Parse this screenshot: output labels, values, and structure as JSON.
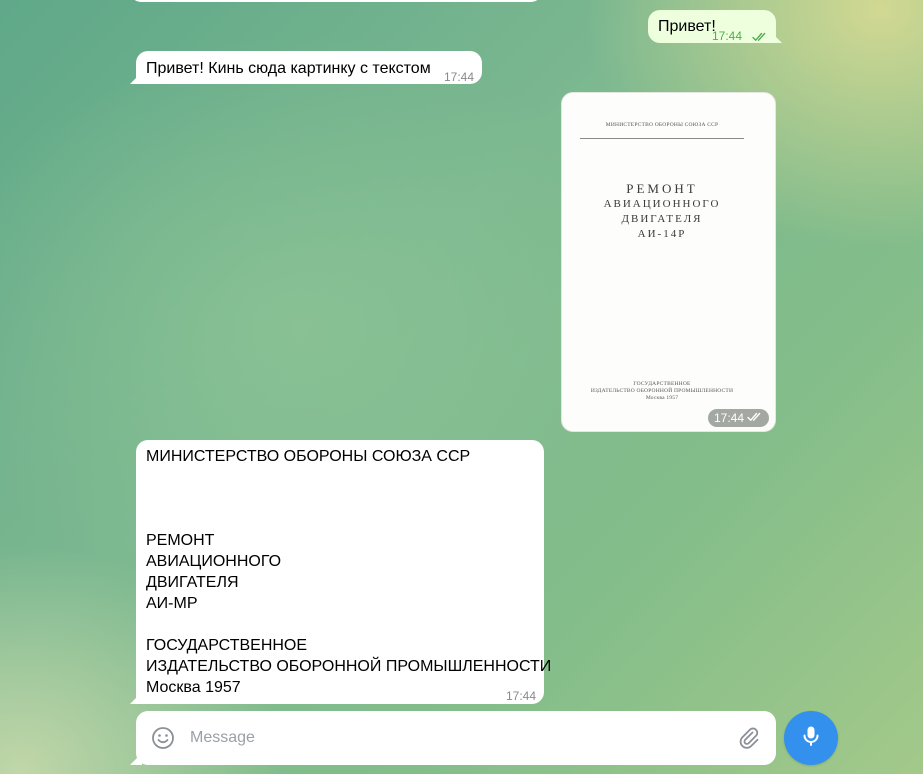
{
  "messages": {
    "greeting": {
      "text": "Привет!",
      "time": "17:44"
    },
    "request": {
      "text": "Привет! Кинь сюда картинку с текстом",
      "time": "17:44"
    },
    "photo": {
      "time": "17:44",
      "document": {
        "header": "МИНИСТЕРСТВО ОБОРОНЫ СОЮЗА ССР",
        "title_1": "РЕМОНТ",
        "title_2": "АВИАЦИОННОГО",
        "title_3": "ДВИГАТЕЛЯ",
        "title_4": "АИ-14Р",
        "footer_1": "ГОСУДАРСТВЕННОЕ",
        "footer_2": "ИЗДАТЕЛЬСТВО ОБОРОННОЙ ПРОМЫШЛЕННОСТИ",
        "footer_3": "Москва 1957"
      }
    },
    "ocr": {
      "lines": [
        "МИНИСТЕРСТВО ОБОРОНЫ СОЮЗА ССР",
        "",
        "",
        "",
        "РЕМОНТ",
        "АВИАЦИОННОГО",
        "ДВИГАТЕЛЯ",
        "АИ-МР",
        "",
        "ГОСУДАРСТВЕННОЕ",
        "ИЗДАТЕЛЬСТВО ОБОРОННОЙ ПРОМЫШЛЕННОСТИ",
        "Москва 1957"
      ],
      "time": "17:44"
    }
  },
  "composer": {
    "placeholder": "Message",
    "value": ""
  },
  "icons": {
    "emoji": "smile-icon",
    "attach": "paperclip-icon",
    "mic": "microphone-icon",
    "read": "double-check-icon"
  },
  "colors": {
    "outgoing_bubble": "#eeffde",
    "incoming_bubble": "#ffffff",
    "accent": "#3390ec",
    "read_check": "#4fae4e"
  }
}
